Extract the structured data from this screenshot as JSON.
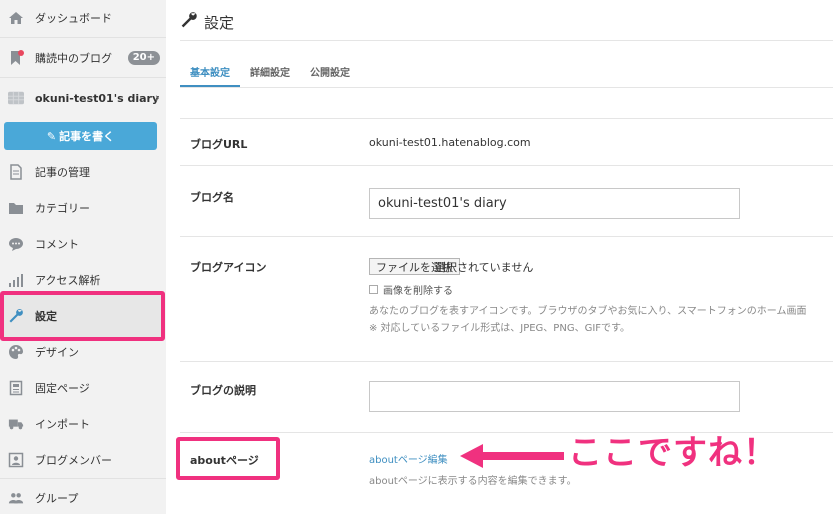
{
  "sidebar": {
    "items": [
      {
        "label": "ダッシュボード",
        "icon": "home-icon"
      },
      {
        "label": "購読中のブログ",
        "icon": "bookmark-icon",
        "badge": "20+"
      },
      {
        "label": "okuni-test01's diary",
        "icon": "blog-avatar-icon"
      },
      {
        "label": "記事の管理",
        "icon": "document-icon"
      },
      {
        "label": "カテゴリー",
        "icon": "folder-icon"
      },
      {
        "label": "コメント",
        "icon": "comment-icon"
      },
      {
        "label": "アクセス解析",
        "icon": "bar-chart-icon"
      },
      {
        "label": "設定",
        "icon": "wrench-icon"
      },
      {
        "label": "デザイン",
        "icon": "palette-icon"
      },
      {
        "label": "固定ページ",
        "icon": "page-icon"
      },
      {
        "label": "インポート",
        "icon": "truck-icon"
      },
      {
        "label": "ブログメンバー",
        "icon": "member-icon"
      },
      {
        "label": "グループ",
        "icon": "group-icon"
      }
    ],
    "write_button": "記事を書く"
  },
  "header": {
    "title": "設定"
  },
  "tabs": [
    {
      "label": "基本設定",
      "active": true
    },
    {
      "label": "詳細設定",
      "active": false
    },
    {
      "label": "公開設定",
      "active": false
    }
  ],
  "form": {
    "blog_url": {
      "label": "ブログURL",
      "value": "okuni-test01.hatenablog.com"
    },
    "blog_name": {
      "label": "ブログ名",
      "value": "okuni-test01's diary"
    },
    "blog_icon": {
      "label": "ブログアイコン",
      "file_button": "ファイルを選択",
      "file_status": "選択されていません",
      "delete_checkbox": "画像を削除する",
      "note1": "あなたのブログを表すアイコンです。ブラウザのタブやお気に入り、スマートフォンのホーム画面",
      "note2": "※ 対応しているファイル形式は、JPEG、PNG、GIFです。"
    },
    "blog_description": {
      "label": "ブログの説明",
      "value": ""
    },
    "about_page": {
      "label": "aboutページ",
      "link": "aboutページ編集",
      "note": "aboutページに表示する内容を編集できます。"
    }
  },
  "annotation": {
    "text": "ここですね！",
    "color": "#f0317f"
  },
  "colors": {
    "accent": "#3f8fc1",
    "button": "#4aa8d8",
    "highlight": "#f0317f",
    "sidebar": "#f2f2f2"
  }
}
